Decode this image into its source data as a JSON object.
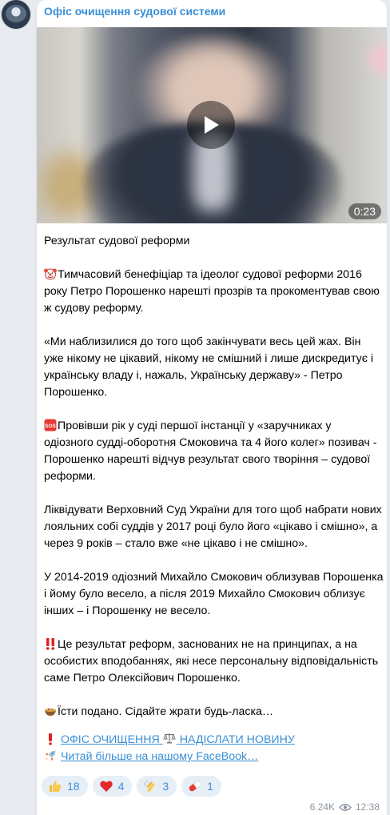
{
  "channel": {
    "name": "Офіс очищення судової системи"
  },
  "video": {
    "duration": "0:23"
  },
  "post": {
    "title": "Результат судової реформи",
    "p1": "Тимчасовий бенефіціар та ідеолог судової реформи 2016 року Петро Порошенко нарешті прозрів та прокоментував свою ж судову реформу.",
    "p2": "«Ми наблизилися до того щоб закінчувати весь цей жах. Він уже нікому не цікавий, нікому не смішний і лише дискредитує і українську владу і, нажаль, Українську державу» - Петро Порошенко.",
    "p3": "Провівши рік у суді першої інстанції у «заручниках у одіозного судді-оборотня Смоковича та 4 його колег» позивач - Порошенко нарешті відчув результат свого творіння – судової реформи.",
    "p4": "Ліквідувати Верховний Суд України для того щоб набрати нових лояльних собі суддів у 2017 році було його «цікаво і смішно», а через 9 років – стало вже «не цікаво і не смішно».",
    "p5": "У 2014-2019 одіозний Михайло Смокович облизував Порошенка і йому було весело, а після 2019 Михайло Смокович облизує інших – і Порошенку не весело.",
    "p6": "Це результат реформ, заснованих не на принципах, а на особистих вподобаннях, які несе персональну відповідальність саме Петро Олексійович Порошенко.",
    "p7": "Їсти подано. Сідайте жрати будь-ласка…",
    "link1_a": "ОФІС ОЧИЩЕННЯ",
    "link1_b": "НАДІСЛАТИ НОВИНУ",
    "link2": "Читай більше на нашому FaceBook…"
  },
  "reactions": [
    {
      "icon": "thumbs-up-icon",
      "count": "18"
    },
    {
      "icon": "heart-icon",
      "count": "4"
    },
    {
      "icon": "clapping-hands-icon",
      "count": "3"
    },
    {
      "icon": "pill-icon",
      "count": "1"
    }
  ],
  "meta": {
    "views": "6.24K",
    "time": "12:38"
  }
}
